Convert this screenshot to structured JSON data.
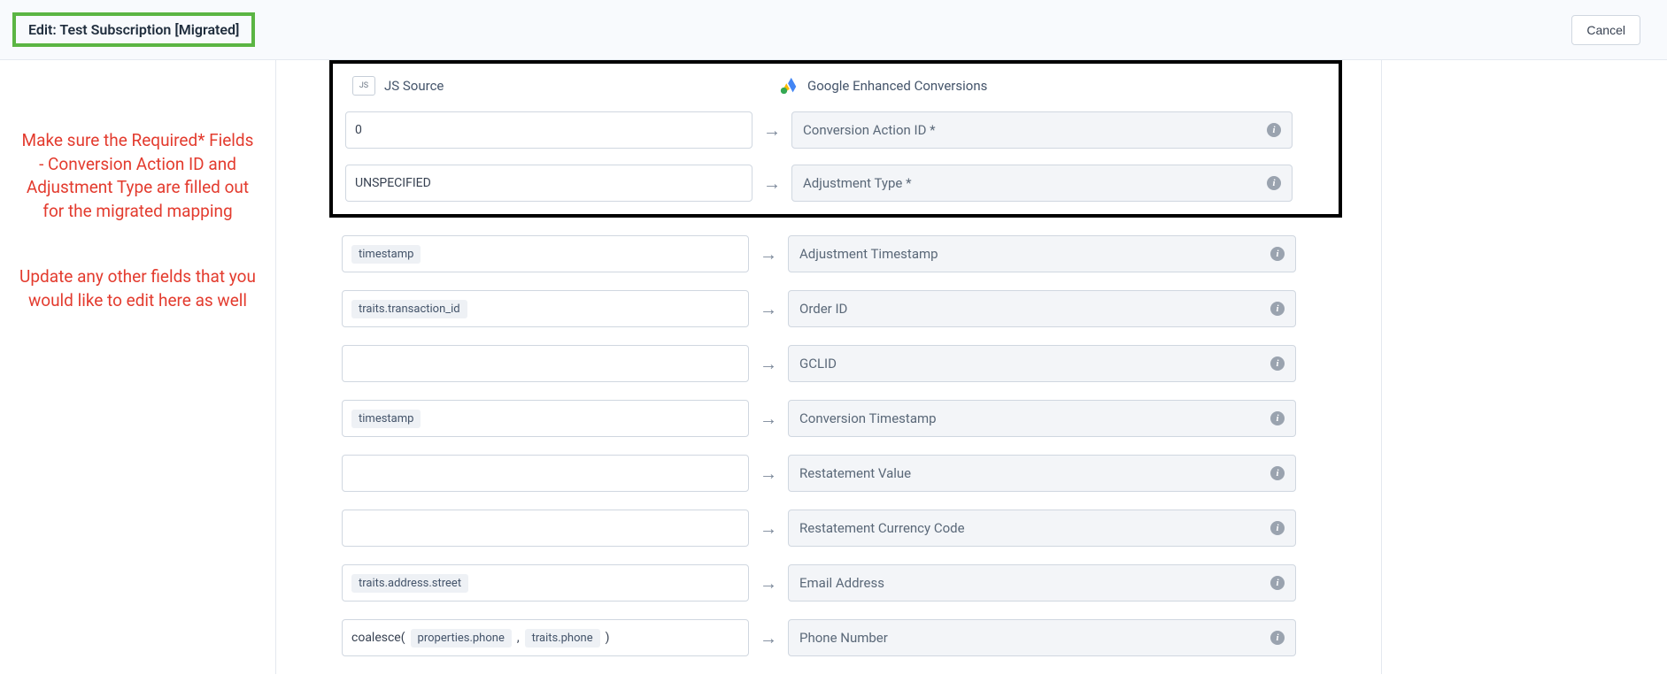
{
  "header": {
    "title": "Edit: Test Subscription [Migrated]",
    "cancel_label": "Cancel"
  },
  "annotations": {
    "a1": "Make sure the Required* Fields - Conversion Action ID and Adjustment Type are filled out for the migrated mapping",
    "a2": "Update any other fields that you would like to edit here as well"
  },
  "sources_header": {
    "left_icon_label": "JS",
    "left_label": "JS Source",
    "right_label": "Google Enhanced Conversions"
  },
  "rows": [
    {
      "source": {
        "tokens": [
          {
            "type": "text",
            "value": "0"
          }
        ]
      },
      "dest_label": "Conversion Action ID *",
      "highlighted": true
    },
    {
      "source": {
        "tokens": [
          {
            "type": "text",
            "value": "UNSPECIFIED"
          }
        ]
      },
      "dest_label": "Adjustment Type *",
      "highlighted": true
    },
    {
      "source": {
        "tokens": [
          {
            "type": "chip",
            "value": "timestamp"
          }
        ]
      },
      "dest_label": "Adjustment Timestamp",
      "highlighted": false
    },
    {
      "source": {
        "tokens": [
          {
            "type": "chip",
            "value": "traits.transaction_id"
          }
        ]
      },
      "dest_label": "Order ID",
      "highlighted": false
    },
    {
      "source": {
        "tokens": []
      },
      "dest_label": "GCLID",
      "highlighted": false
    },
    {
      "source": {
        "tokens": [
          {
            "type": "chip",
            "value": "timestamp"
          }
        ]
      },
      "dest_label": "Conversion Timestamp",
      "highlighted": false
    },
    {
      "source": {
        "tokens": []
      },
      "dest_label": "Restatement Value",
      "highlighted": false
    },
    {
      "source": {
        "tokens": []
      },
      "dest_label": "Restatement Currency Code",
      "highlighted": false
    },
    {
      "source": {
        "tokens": [
          {
            "type": "chip",
            "value": "traits.address.street"
          }
        ]
      },
      "dest_label": "Email Address",
      "highlighted": false
    },
    {
      "source": {
        "tokens": [
          {
            "type": "text",
            "value": "coalesce("
          },
          {
            "type": "chip",
            "value": "properties.phone"
          },
          {
            "type": "text",
            "value": ","
          },
          {
            "type": "chip",
            "value": "traits.phone"
          },
          {
            "type": "text",
            "value": ")"
          }
        ]
      },
      "dest_label": "Phone Number",
      "highlighted": false
    }
  ]
}
